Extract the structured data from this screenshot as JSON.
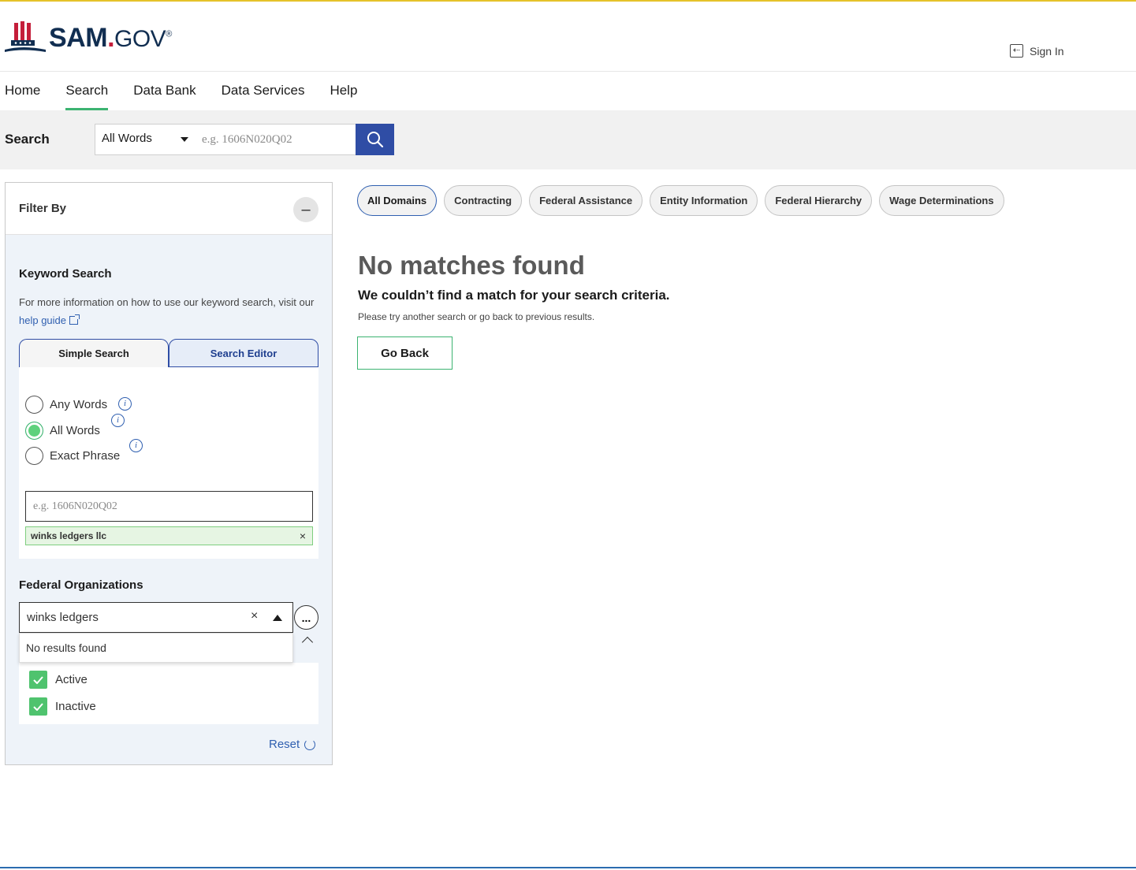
{
  "brand": {
    "name_main": "SAM",
    "name_dot": ".",
    "name_suffix": "GOV",
    "mark": "®"
  },
  "header": {
    "signin_label": "Sign In",
    "signin_icon": "sign-in-icon"
  },
  "nav": {
    "items": [
      {
        "label": "Home",
        "active": false
      },
      {
        "label": "Search",
        "active": true
      },
      {
        "label": "Data Bank",
        "active": false
      },
      {
        "label": "Data Services",
        "active": false
      },
      {
        "label": "Help",
        "active": false
      }
    ]
  },
  "search_bar": {
    "label": "Search",
    "mode_selected": "All Words",
    "placeholder": "e.g. 1606N020Q02",
    "button_icon": "search-icon"
  },
  "filter": {
    "title": "Filter By",
    "collapse_symbol": "–",
    "keyword": {
      "title": "Keyword Search",
      "help_text": "For more information on how to use our keyword search, visit our",
      "help_link": "help guide",
      "tabs": [
        {
          "label": "Simple Search",
          "active": true
        },
        {
          "label": "Search Editor",
          "active": false
        }
      ],
      "options": [
        {
          "label": "Any Words",
          "checked": false
        },
        {
          "label": "All Words",
          "checked": true
        },
        {
          "label": "Exact Phrase",
          "checked": false
        }
      ],
      "placeholder": "e.g. 1606N020Q02",
      "chip": "winks ledgers llc",
      "chip_remove": "×"
    },
    "federal_orgs": {
      "title": "Federal Organizations",
      "input_value": "winks ledgers",
      "clear_symbol": "×",
      "more_symbol": "...",
      "dropdown_text": "No results found",
      "statuses": [
        {
          "label": "Active",
          "checked": true
        },
        {
          "label": "Inactive",
          "checked": true
        }
      ]
    },
    "reset_label": "Reset"
  },
  "domains": {
    "tabs": [
      {
        "label": "All Domains",
        "active": true
      },
      {
        "label": "Contracting",
        "active": false
      },
      {
        "label": "Federal Assistance",
        "active": false
      },
      {
        "label": "Entity Information",
        "active": false
      },
      {
        "label": "Federal Hierarchy",
        "active": false
      },
      {
        "label": "Wage Determinations",
        "active": false
      }
    ]
  },
  "results": {
    "title": "No matches found",
    "subtitle": "We couldn’t find a match for your search criteria.",
    "hint": "Please try another search or go back to previous results.",
    "go_back_label": "Go Back"
  },
  "colors": {
    "accent_green": "#3cb371",
    "primary_blue": "#2f4da5",
    "brand_navy": "#112e51",
    "brand_red": "#c41e3a"
  }
}
